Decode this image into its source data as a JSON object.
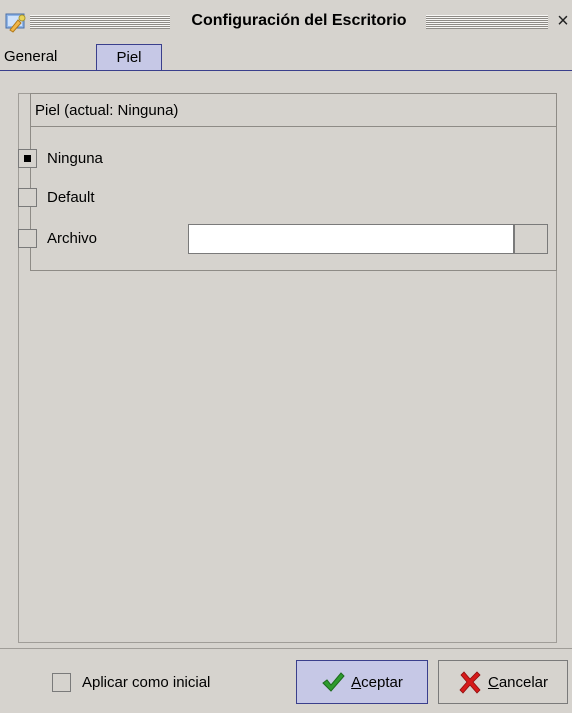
{
  "window": {
    "title": "Configuración del Escritorio",
    "close_glyph": "×",
    "icon": "desktop-settings-icon"
  },
  "tabs": [
    {
      "label": "General",
      "selected": false
    },
    {
      "label": "Piel",
      "selected": true
    }
  ],
  "skin_group": {
    "header": "Piel (actual: Ninguna)",
    "options": [
      {
        "label": "Ninguna",
        "checked": true
      },
      {
        "label": "Default",
        "checked": false
      },
      {
        "label": "Archivo",
        "checked": false
      }
    ],
    "file_value": ""
  },
  "footer": {
    "apply_label": "Aplicar como inicial",
    "apply_checked": false,
    "accept": {
      "mnemonic": "A",
      "rest": "ceptar",
      "icon": "check-icon"
    },
    "cancel": {
      "mnemonic": "C",
      "rest": "ancelar",
      "icon": "x-icon"
    }
  },
  "colors": {
    "background": "#d6d3ce",
    "selection": "#c6c8e6",
    "selection_border": "#3a3f8c",
    "accept_check": "#2e9b2e",
    "cancel_x": "#d61a1a"
  }
}
